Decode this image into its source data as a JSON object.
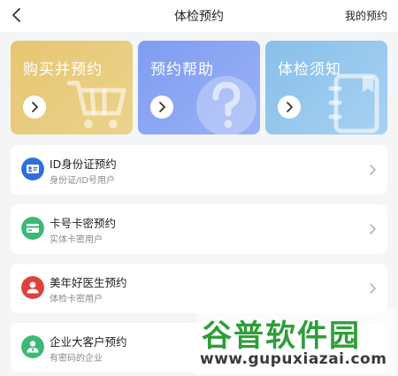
{
  "nav": {
    "title": "体检预约",
    "right_link": "我的预约"
  },
  "cards": [
    {
      "title": "购买并预约",
      "color": "#e6c671"
    },
    {
      "title": "预约帮助",
      "color": "#7f9cf1"
    },
    {
      "title": "体检须知",
      "color": "#88bfe9"
    }
  ],
  "list": [
    {
      "title": "ID身份证预约",
      "subtitle": "身份证/ID号用户",
      "icon": "id-card-icon",
      "color": "#2e6fd8"
    },
    {
      "title": "卡号卡密预约",
      "subtitle": "实体卡密用户",
      "icon": "card-icon",
      "color": "#3cb878"
    },
    {
      "title": "美年好医生预约",
      "subtitle": "体检卡密用户",
      "icon": "doctor-icon",
      "color": "#e0413b"
    },
    {
      "title": "企业大客户预约",
      "subtitle": "有密码的企业",
      "icon": "enterprise-icon",
      "color": "#3cb878"
    }
  ],
  "watermark": {
    "big": "谷普软件园",
    "small": "www.gupuxiazai.com"
  }
}
